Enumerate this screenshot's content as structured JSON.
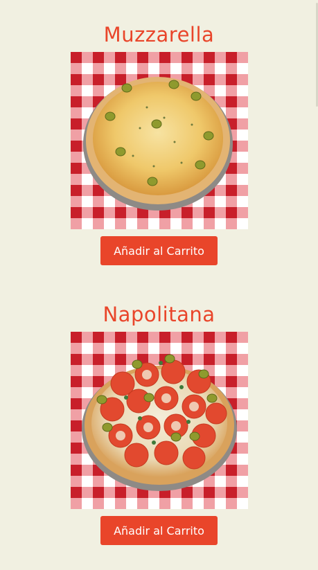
{
  "theme": {
    "background": "#f1f0e1",
    "accent": "#e9452a",
    "button_text": "#ffffff",
    "tablecloth_red": "#d8242e"
  },
  "products": [
    {
      "name": "Muzzarella",
      "button_label": "Añadir al Carrito",
      "image_icon": "pizza-muzzarella-image"
    },
    {
      "name": "Napolitana",
      "button_label": "Añadir al Carrito",
      "image_icon": "pizza-napolitana-image"
    }
  ]
}
